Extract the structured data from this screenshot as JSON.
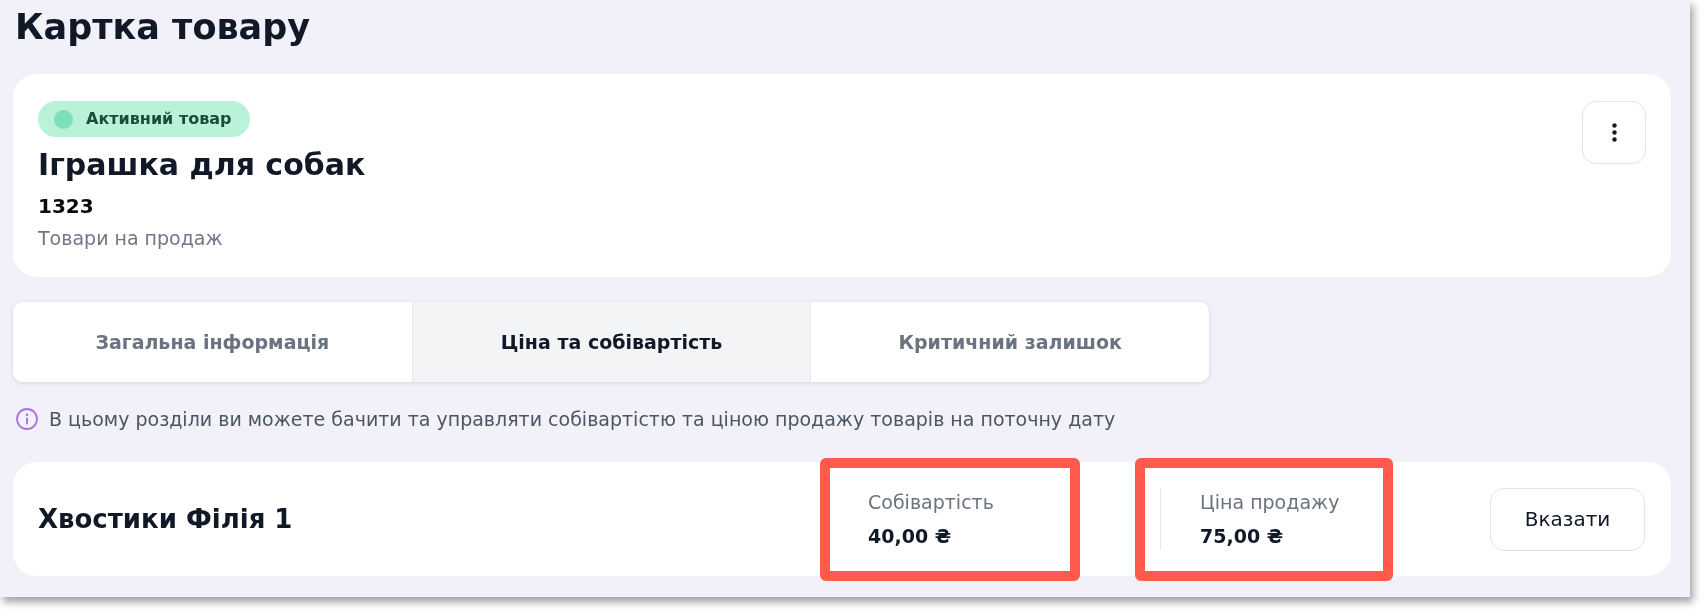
{
  "page": {
    "title": "Картка товару"
  },
  "product": {
    "status": {
      "label": "Активний товар",
      "active": true
    },
    "name": "Іграшка для собак",
    "code": "1323",
    "category": "Товари на продаж"
  },
  "tabs": [
    {
      "label": "Загальна інформація",
      "selected": false
    },
    {
      "label": "Ціна та собівартість",
      "selected": true
    },
    {
      "label": "Критичний залишок",
      "selected": false
    }
  ],
  "info_note": "В цьому розділи ви можете бачити та управляти собівартістю та ціною продажу товарів на поточну дату",
  "branches": [
    {
      "name": "Хвостики Філія 1",
      "metrics": [
        {
          "label": "Собівартість",
          "value": "40,00 ₴",
          "highlighted": true
        },
        {
          "label": "Ціна продажу",
          "value": "75,00 ₴",
          "highlighted": true
        }
      ],
      "action": "Вказати"
    }
  ]
}
